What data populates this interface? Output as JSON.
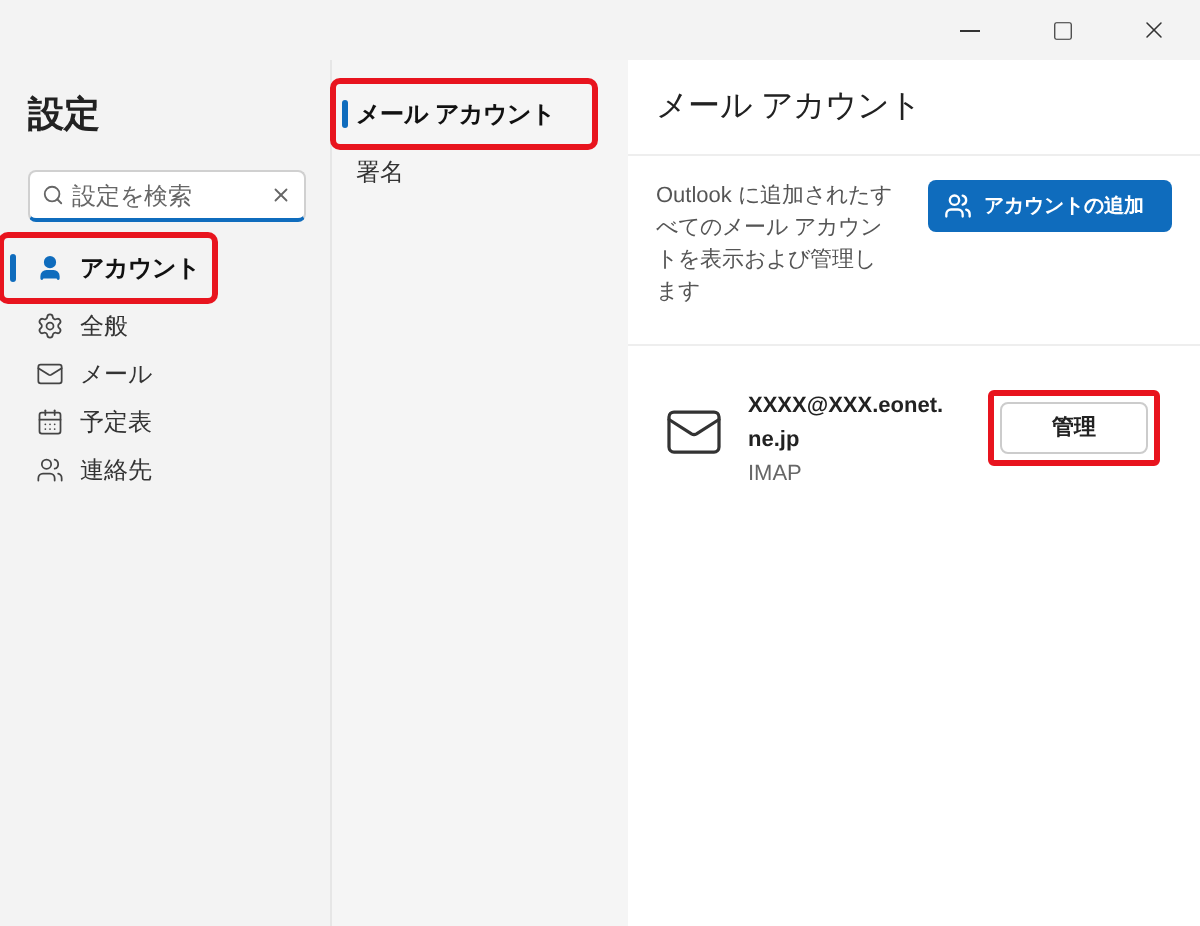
{
  "window": {
    "controls": [
      {
        "kind": "minimize"
      },
      {
        "kind": "maximize"
      },
      {
        "kind": "close"
      }
    ]
  },
  "sidebar": {
    "title": "設定",
    "search": {
      "placeholder": "設定を検索"
    },
    "items": [
      {
        "label": "アカウント",
        "kind": "person",
        "selected": true,
        "highlighted": true
      },
      {
        "label": "全般",
        "kind": "gear",
        "selected": false,
        "highlighted": false
      },
      {
        "label": "メール",
        "kind": "mail",
        "selected": false,
        "highlighted": false
      },
      {
        "label": "予定表",
        "kind": "calendar",
        "selected": false,
        "highlighted": false
      },
      {
        "label": "連絡先",
        "kind": "people",
        "selected": false,
        "highlighted": false
      }
    ]
  },
  "subnav": {
    "items": [
      {
        "label": "メール アカウント",
        "selected": true,
        "highlighted": true
      },
      {
        "label": "署名",
        "selected": false,
        "highlighted": false
      }
    ]
  },
  "content": {
    "title": "メール アカウント",
    "description": "Outlook に追加されたすべてのメール アカウントを表示および管理します",
    "add_button": "アカウントの追加",
    "accounts": [
      {
        "email": "XXXX@XXX.eonet.ne.jp",
        "type": "IMAP",
        "manage_button": "管理",
        "highlighted": true
      }
    ]
  }
}
